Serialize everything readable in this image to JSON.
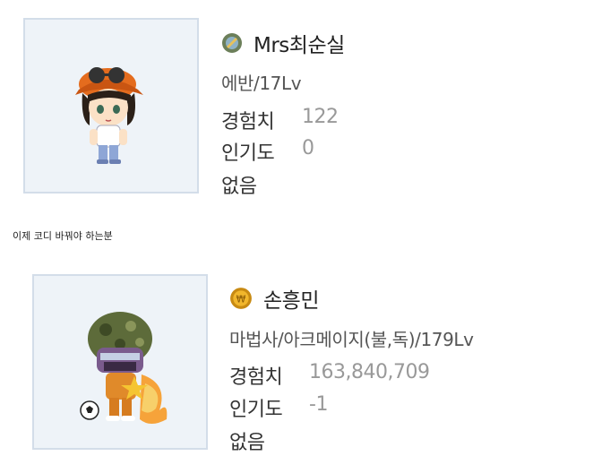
{
  "characters": [
    {
      "name": "Mrs최순실",
      "world_icon": "reboot-world-icon",
      "job": "에반/17Lv",
      "exp_label": "경험치",
      "exp_value": "122",
      "fame_label": "인기도",
      "fame_value": "0",
      "guild": "없음"
    },
    {
      "name": "손흥민",
      "world_icon": "gold-coin-world-icon",
      "job": "마법사/아크메이지(불,독)/179Lv",
      "exp_label": "경험치",
      "exp_value": "163,840,709",
      "fame_label": "인기도",
      "fame_value": "-1",
      "guild": "없음"
    }
  ],
  "caption": "이제 코디 바꿔야 하는분",
  "colors": {
    "avatar_bg": "#eef3f8",
    "avatar_border": "#d3dde9",
    "value_gray": "#999999"
  }
}
